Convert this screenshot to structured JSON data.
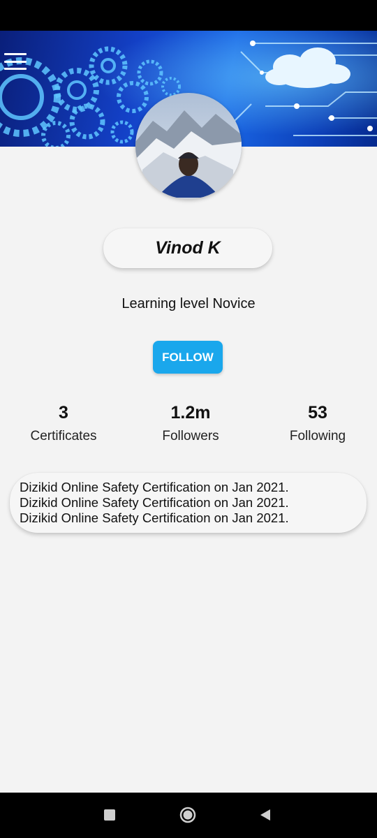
{
  "profile": {
    "name": "Vinod K",
    "level_text": "Learning level Novice",
    "follow_label": "FOLLOW"
  },
  "stats": [
    {
      "value": "3",
      "label": "Certificates"
    },
    {
      "value": "1.2m",
      "label": "Followers"
    },
    {
      "value": "53",
      "label": "Following"
    }
  ],
  "certificates": [
    "Dizikid Online Safety Certification on Jan 2021.",
    "Dizikid Online Safety Certification on Jan 2021.",
    "Dizikid Online Safety Certification on Jan 2021."
  ],
  "icons": {
    "menu": "hamburger-menu-icon",
    "nav_recents": "square-icon",
    "nav_home": "circle-icon",
    "nav_back": "back-triangle-icon"
  },
  "colors": {
    "accent": "#1aa7ec",
    "background": "#f3f3f3",
    "system_bar": "#000000"
  }
}
